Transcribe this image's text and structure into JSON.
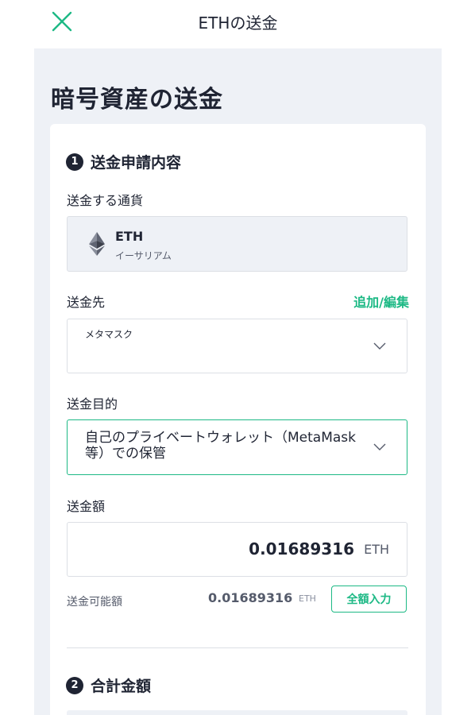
{
  "header": {
    "title": "ETHの送金",
    "close_icon": "close-icon"
  },
  "page": {
    "title": "暗号資産の送金"
  },
  "section1": {
    "number": "1",
    "title": "送金申請内容"
  },
  "currency": {
    "label": "送金する通貨",
    "code": "ETH",
    "name": "イーサリアム",
    "icon": "ethereum-icon"
  },
  "destination": {
    "label": "送金先",
    "edit_link": "追加/編集",
    "value": "メタマスク"
  },
  "purpose": {
    "label": "送金目的",
    "value": "自己のプライベートウォレット（MetaMask等）での保管"
  },
  "amount": {
    "label": "送金額",
    "value": "0.01689316",
    "unit": "ETH"
  },
  "available": {
    "label": "送金可能額",
    "value": "0.01689316",
    "unit": "ETH",
    "fill_button": "全額入力"
  },
  "section2": {
    "number": "2",
    "title": "合計金額"
  },
  "colors": {
    "accent": "#1db985",
    "dark": "#1f2433",
    "background": "#eef1f6"
  }
}
